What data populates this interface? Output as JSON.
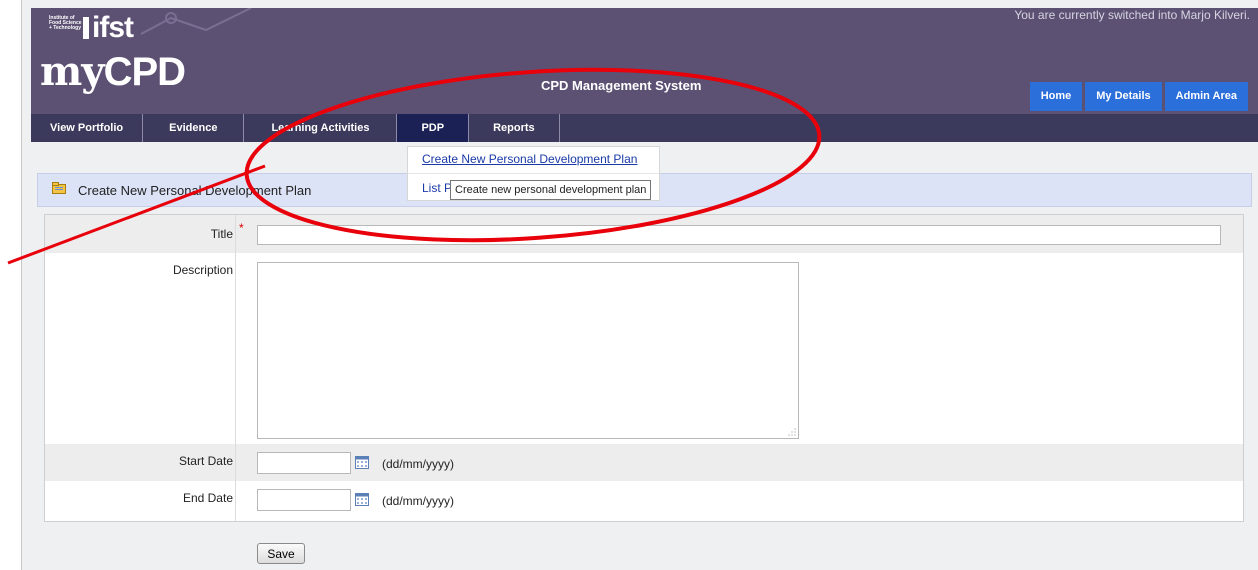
{
  "header": {
    "logo_small": "Institute of Food Science + Technology",
    "logo_ifst": "ifst",
    "logo_my": "my",
    "logo_cpd": "CPD",
    "switched_notice": "You are currently switched into Marjo Kilveri.",
    "system_title": "CPD Management System",
    "top_buttons": [
      "Home",
      "My Details",
      "Admin Area"
    ]
  },
  "nav": {
    "items": [
      "View Portfolio",
      "Evidence",
      "Learning Activities",
      "PDP",
      "Reports"
    ],
    "active": "PDP"
  },
  "dropdown": {
    "items": [
      "Create New Personal Development Plan",
      "List P"
    ],
    "tooltip": "Create new personal development plan"
  },
  "page": {
    "heading": "Create New Personal Development Plan"
  },
  "form": {
    "title_label": "Title",
    "required_mark": "*",
    "title_value": "",
    "description_label": "Description",
    "description_value": "",
    "start_date_label": "Start Date",
    "end_date_label": "End Date",
    "start_date_value": "",
    "end_date_value": "",
    "date_hint": "(dd/mm/yyyy)",
    "save_label": "Save"
  },
  "colors": {
    "header_bg": "#5c5173",
    "nav_bg": "#3b3a5c",
    "nav_active": "#1b2155",
    "button_blue": "#2b6fdb",
    "heading_band": "#dde3f7",
    "annotation_red": "#e8000b"
  }
}
